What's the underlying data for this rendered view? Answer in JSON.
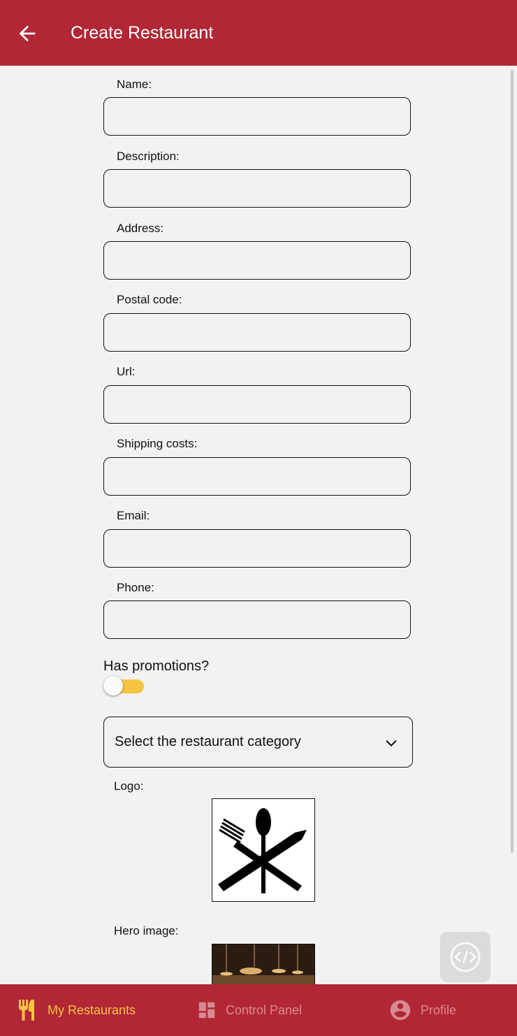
{
  "header": {
    "title": "Create Restaurant",
    "back_icon": "arrow-back-icon",
    "bg_color": "#b12735"
  },
  "form": {
    "fields": [
      {
        "label": "Name:",
        "value": ""
      },
      {
        "label": "Description:",
        "value": ""
      },
      {
        "label": "Address:",
        "value": ""
      },
      {
        "label": "Postal code:",
        "value": ""
      },
      {
        "label": "Url:",
        "value": ""
      },
      {
        "label": "Shipping costs:",
        "value": ""
      },
      {
        "label": "Email:",
        "value": ""
      },
      {
        "label": "Phone:",
        "value": ""
      }
    ],
    "promotions_label": "Has promotions?",
    "promotions_on": false,
    "category_placeholder": "Select the restaurant category",
    "logo_label": "Logo:",
    "hero_label": "Hero image:"
  },
  "bottom_nav": {
    "items": [
      {
        "label": "My Restaurants",
        "icon": "restaurant-icon",
        "active": true
      },
      {
        "label": "Control Panel",
        "icon": "dashboard-icon",
        "active": false
      },
      {
        "label": "Profile",
        "icon": "account-circle-icon",
        "active": false
      }
    ],
    "active_color": "#f5c443",
    "inactive_color": "#d98a90"
  }
}
